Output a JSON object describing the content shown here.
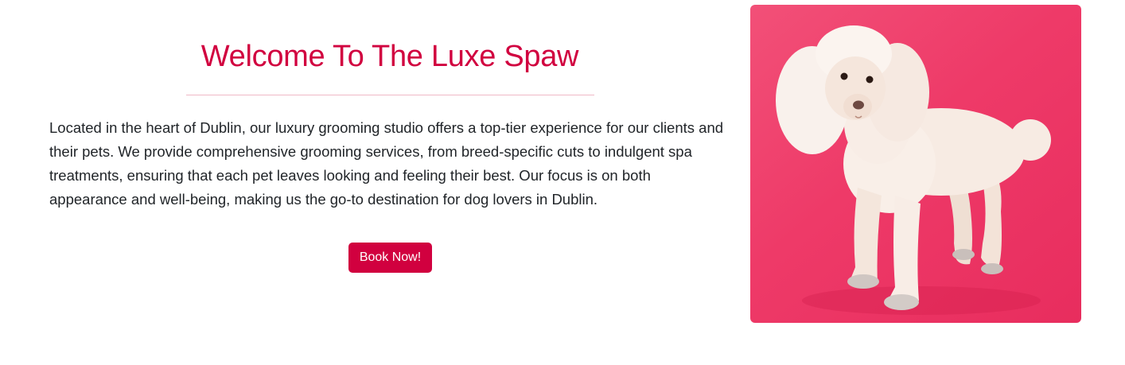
{
  "intro": {
    "title": "Welcome To The Luxe Spaw",
    "description": "Located in the heart of Dublin, our luxury grooming studio offers a top-tier experience for our clients and their pets. We provide comprehensive grooming services, from breed-specific cuts to indulgent spa treatments, ensuring that each pet leaves looking and feeling their best. Our focus is on both appearance and well-being, making us the go-to destination for dog lovers in Dublin.",
    "cta_label": "Book Now!"
  },
  "photo": {
    "icon": "poodle-photo"
  },
  "colors": {
    "accent": "#d1003f",
    "divider": "#f0b9c6",
    "photo_background": "#ee3a68",
    "body_text": "#212529"
  }
}
